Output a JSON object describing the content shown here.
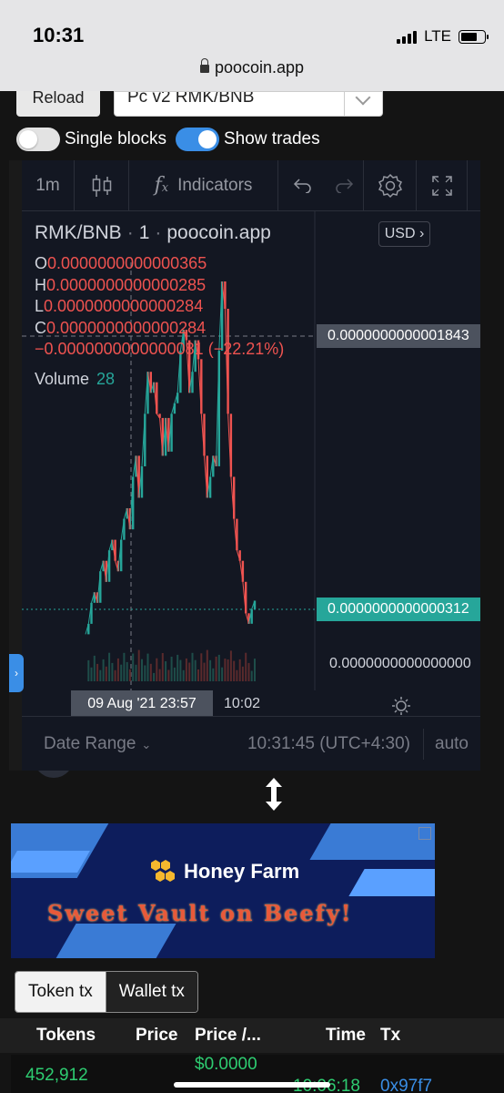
{
  "status_bar": {
    "time": "10:31",
    "network": "LTE",
    "url": "poocoin.app"
  },
  "controls": {
    "reload_label": "Reload",
    "pair_selected": "Pc v2 RMK/BNB",
    "single_blocks_label": "Single blocks",
    "single_blocks_on": false,
    "show_trades_label": "Show trades",
    "show_trades_on": true
  },
  "chart_toolbar": {
    "interval": "1m",
    "indicators_label": "Indicators"
  },
  "chart_legend": {
    "symbol": "RMK/BNB",
    "interval": "1",
    "source": "poocoin.app",
    "open_label": "O",
    "open": "0.0000000000000365",
    "high_label": "H",
    "high": "0.0000000000000285",
    "low_label": "L",
    "low": "0.0000000000000284",
    "close_label": "C",
    "close": "0.0000000000000284",
    "change": "−0.0000000000000081 (−22.21%)",
    "volume_label": "Volume",
    "volume": "28"
  },
  "chart": {
    "currency_button": "USD",
    "high_marker": "0.0000000000001843",
    "last_price_marker": "0.0000000000000312",
    "zero_label": "0.0000000000000000",
    "crosshair_time": "09 Aug '21   23:57",
    "time_tick": "10:02",
    "up_color": "#26a69a",
    "down_color": "#ef5350"
  },
  "chart_data": {
    "type": "line",
    "title": "",
    "xlabel": "",
    "ylabel": "",
    "x_ticks": [
      "10:02"
    ],
    "y_ticks": [
      "0.0000000000000000",
      "0.0000000000000312",
      "0.0000000000001843"
    ],
    "series": [
      {
        "values": [
          0.015,
          0.02,
          0.03,
          0.035,
          0.03,
          0.045,
          0.05,
          0.04,
          0.055,
          0.06,
          0.05,
          0.045,
          0.06,
          0.07,
          0.075,
          0.065,
          0.09,
          0.1,
          0.08,
          0.095,
          0.12,
          0.14,
          0.13,
          0.135,
          0.12,
          0.118,
          0.1,
          0.118,
          0.102,
          0.12,
          0.125,
          0.13,
          0.15,
          0.16,
          0.155,
          0.13,
          0.14,
          0.155,
          0.146,
          0.12,
          0.1,
          0.08,
          0.09,
          0.1,
          0.095,
          0.15,
          0.183,
          0.17,
          0.12,
          0.09,
          0.07,
          0.055,
          0.05,
          0.04,
          0.025,
          0.02,
          0.027,
          0.031
        ]
      }
    ]
  },
  "chart_footer": {
    "date_range_label": "Date Range",
    "clock": "10:31:45 (UTC+4:30)",
    "auto_label": "auto"
  },
  "ad": {
    "brand": "Honey Farm",
    "headline": "Sweet Vault on Beefy!"
  },
  "tx_tabs": {
    "token_tx": "Token tx",
    "wallet_tx": "Wallet tx"
  },
  "tx_table": {
    "headers": [
      "Tokens",
      "Price",
      "Price /...",
      "Time",
      "Tx"
    ],
    "rows": [
      {
        "tokens": "452,912",
        "price": "",
        "price_per": "$0.0000",
        "time": "10:06:18",
        "tx": "0x97f7"
      }
    ]
  }
}
